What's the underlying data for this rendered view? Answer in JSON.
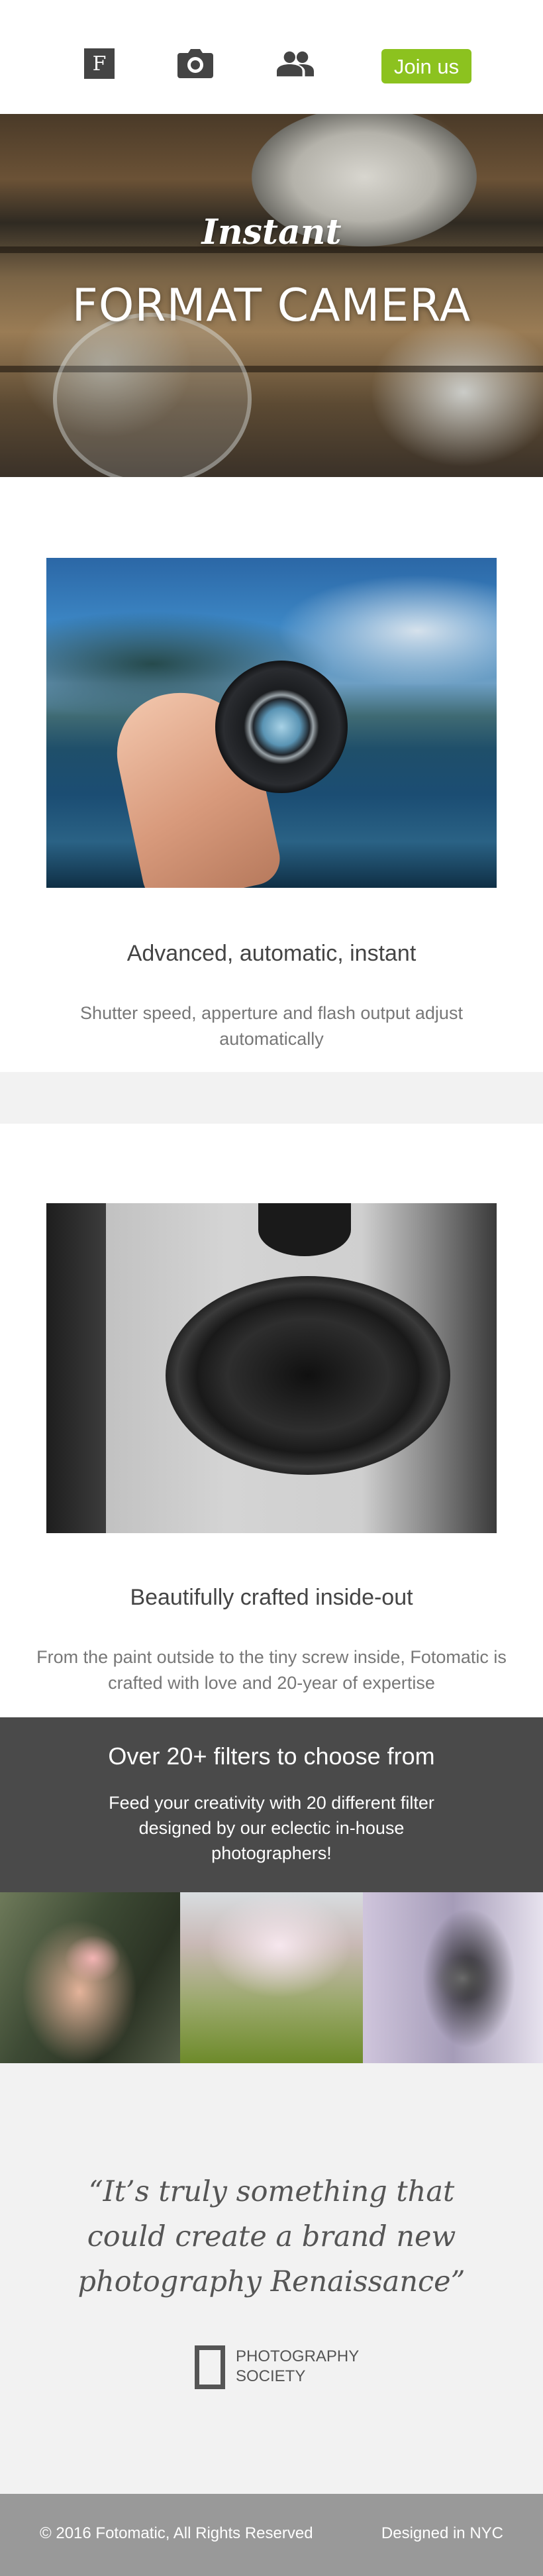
{
  "header": {
    "logo_letter": "F",
    "join_label": "Join us",
    "accent_color": "#8cc21f",
    "icons": [
      "logo-icon",
      "camera-icon",
      "people-icon"
    ]
  },
  "hero": {
    "script_title": "Instant",
    "title": "FORMAT CAMERA"
  },
  "features": [
    {
      "heading": "Advanced, automatic, instant",
      "description": "Shutter speed, apperture and flash output adjust automatically"
    },
    {
      "heading": "Beautifully crafted inside-out",
      "description": "From the paint outside to the tiny screw inside, Fotomatic is crafted with love and 20-year of expertise"
    }
  ],
  "filters": {
    "heading": "Over 20+ filters to choose from",
    "description": "Feed your creativity with 20 different filter designed by our eclectic in-house photographers!"
  },
  "testimonial": {
    "quote": "“It’s truly something that could create a brand new photography Renaissance”",
    "source_line1": "PHOTOGRAPHY",
    "source_line2": "SOCIETY"
  },
  "footer": {
    "copyright": "© 2016 Fotomatic, All Rights Reserved",
    "designed": "Designed in NYC"
  }
}
